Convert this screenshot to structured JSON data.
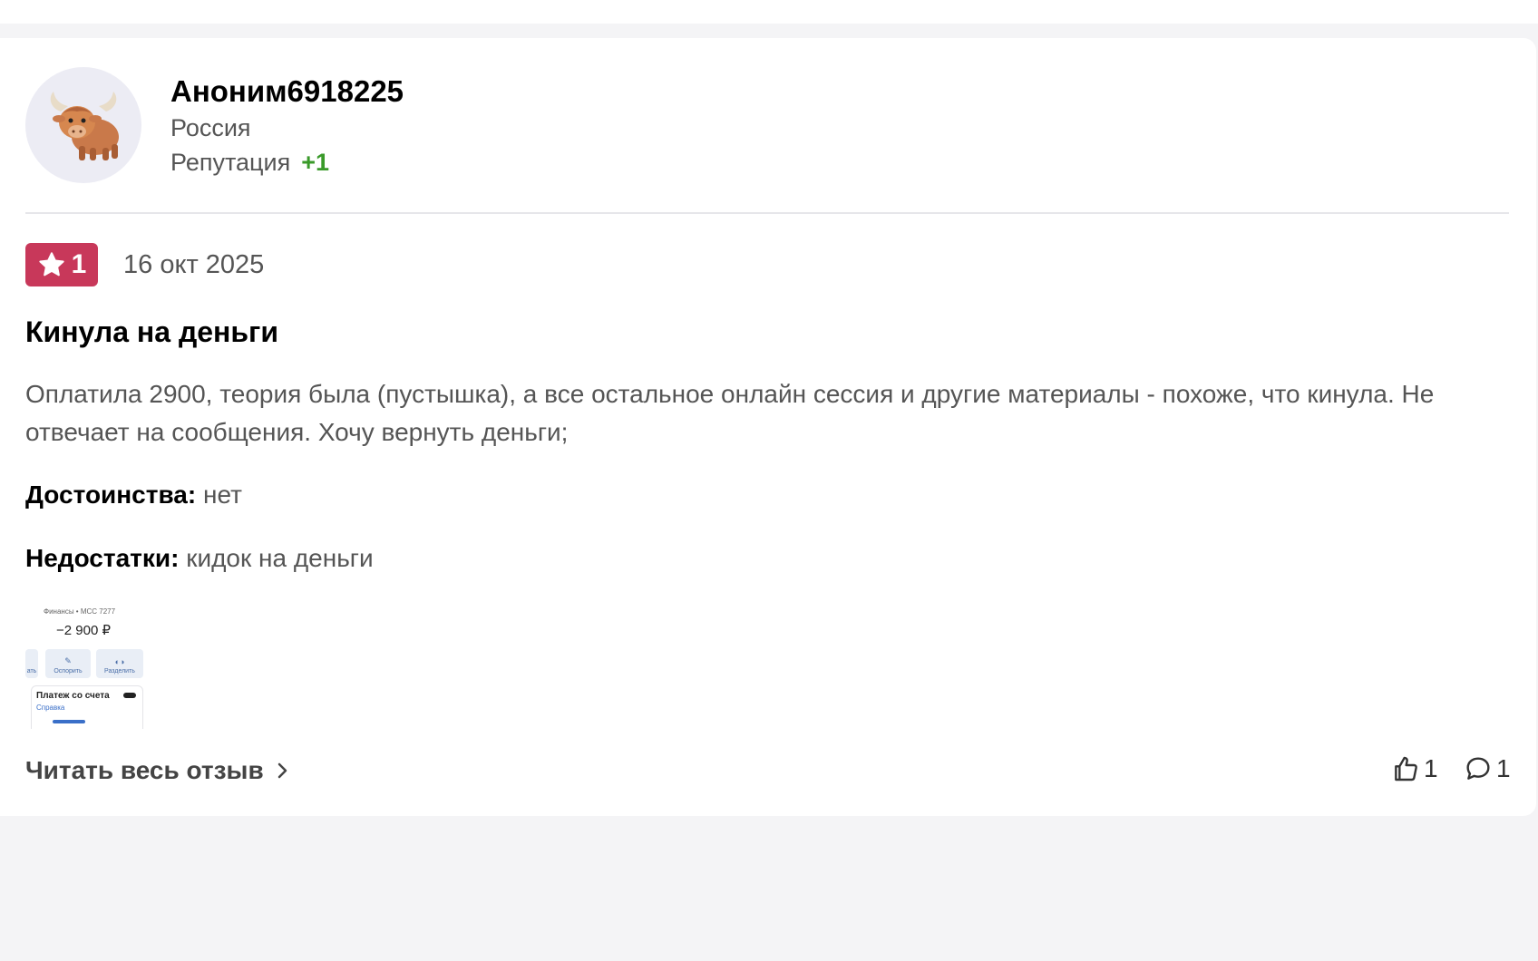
{
  "author": {
    "name": "Аноним6918225",
    "country": "Россия",
    "reputation_label": "Репутация",
    "reputation_value": "+1",
    "avatar_icon": "yak-emoji-icon"
  },
  "review": {
    "rating": "1",
    "rating_color": "#c8385a",
    "date": "16 окт 2025",
    "title": "Кинула на деньги",
    "body": "Оплатила 2900, теория была (пустышка), а все остальное онлайн сессия и другие материалы - похоже, что кинула. Не отвечает на сообщения. Хочу вернуть деньги;",
    "pros_label": "Достоинства:",
    "pros": "нет",
    "cons_label": "Недостатки:",
    "cons": "кидок на деньги"
  },
  "attachment": {
    "meta": "Финансы • МСС 7277",
    "amount": "−2 900 ₽",
    "button_1": "ать",
    "button_2": "Оспорить",
    "button_3": "Разделить",
    "card_title": "Платеж со счета",
    "card_link": "Справка"
  },
  "footer": {
    "read_more": "Читать весь отзыв",
    "likes": "1",
    "comments": "1"
  }
}
